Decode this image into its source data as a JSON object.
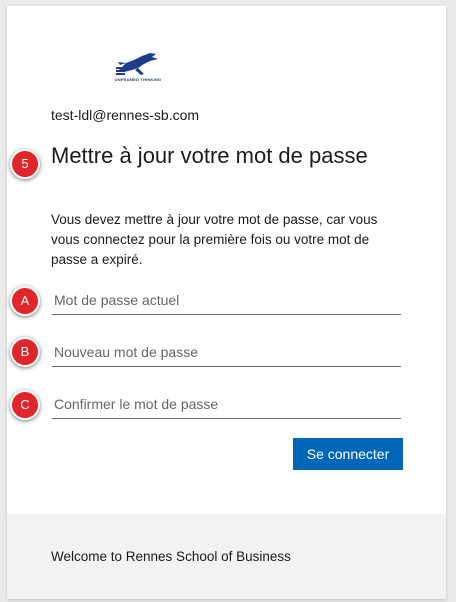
{
  "logo": {
    "icon": "leaping-horse-logo",
    "tagline": "UNFRAMED THINKING",
    "color": "#1f3c88"
  },
  "account": {
    "email": "test-ldl@rennes-sb.com"
  },
  "title": "Mettre à jour votre mot de passe",
  "description": "Vous devez mettre à jour votre mot de passe, car vous vous connectez pour la première fois ou votre mot de passe a expiré.",
  "fields": {
    "current_password": {
      "placeholder": "Mot de passe actuel",
      "value": ""
    },
    "new_password": {
      "placeholder": "Nouveau mot de passe",
      "value": ""
    },
    "confirm_password": {
      "placeholder": "Confirmer le mot de passe",
      "value": ""
    }
  },
  "markers": {
    "title": "5",
    "current_password": "A",
    "new_password": "B",
    "confirm_password": "C"
  },
  "submit_button": {
    "label": "Se connecter",
    "color": "#0067b8"
  },
  "footer": {
    "text": "Welcome to Rennes School of Business"
  },
  "colors": {
    "marker": "#e0252b"
  }
}
